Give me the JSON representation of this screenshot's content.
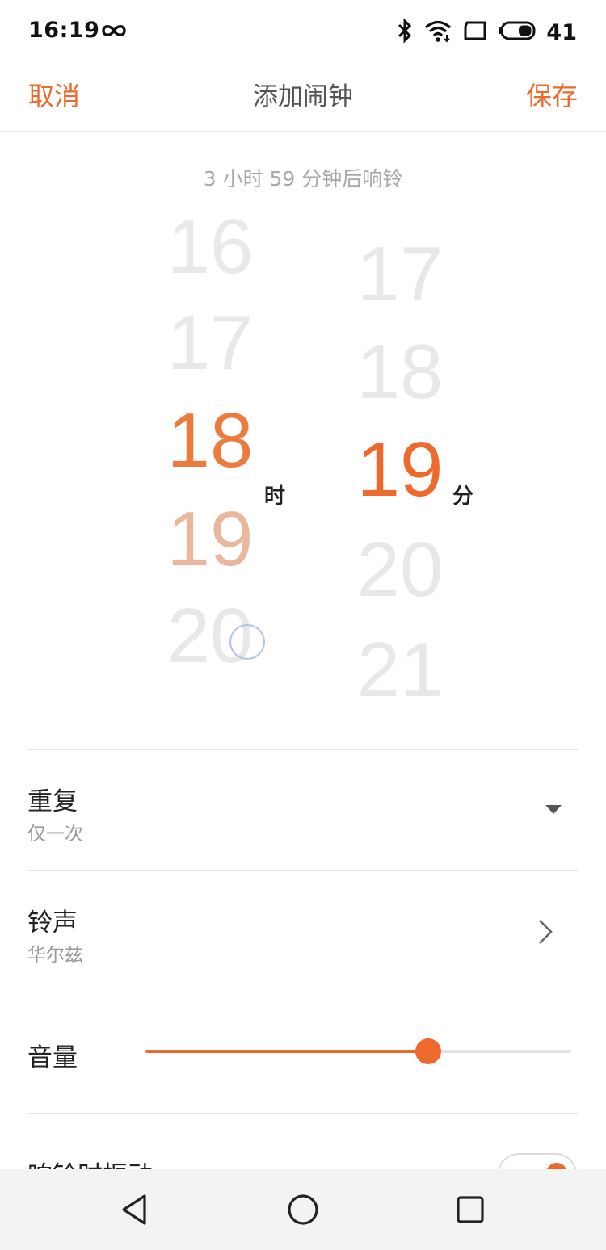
{
  "status_bar": {
    "time": "16:19",
    "battery_level": "41"
  },
  "header": {
    "cancel": "取消",
    "title": "添加闹钟",
    "save": "保存"
  },
  "countdown": "3 小时 59 分钟后响铃",
  "picker": {
    "hours": [
      "16",
      "17",
      "18",
      "19",
      "20"
    ],
    "selected_hour": "18",
    "hour_unit": "时",
    "minutes": [
      "17",
      "18",
      "19",
      "20",
      "21"
    ],
    "selected_minute": "19",
    "minute_unit": "分"
  },
  "repeat": {
    "title": "重复",
    "value": "仅一次"
  },
  "ringtone": {
    "title": "铃声",
    "value": "华尔兹"
  },
  "volume": {
    "title": "音量",
    "level": 0.665
  },
  "vibrate": {
    "title": "响铃时振动",
    "on": true
  },
  "colors": {
    "accent": "#ee6a2c",
    "hour_selected": "#ee7b3e",
    "hour_next": "#e8b79c",
    "inactive_number": "#e8e8e8"
  },
  "nav": {
    "icons": [
      "back-icon",
      "home-icon",
      "recents-icon"
    ]
  }
}
